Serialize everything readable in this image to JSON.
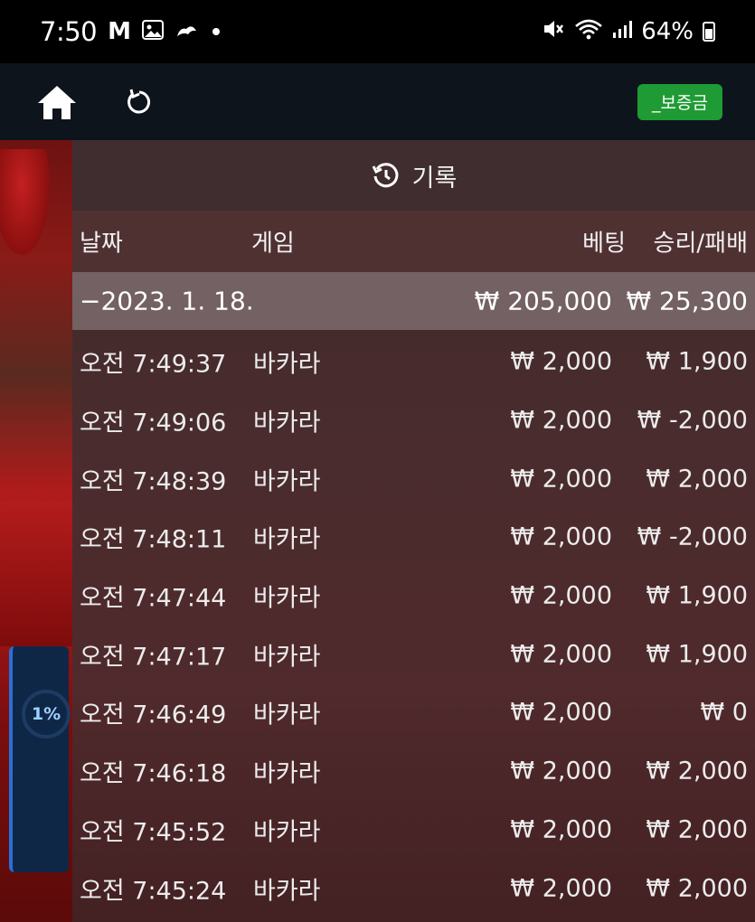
{
  "status_bar": {
    "time": "7:50",
    "app_icons": [
      "gmail-icon",
      "gallery-icon",
      "weather-icon"
    ],
    "battery": "64%"
  },
  "toolbar": {
    "deposit_label": "_보증금"
  },
  "left_overlay": {
    "percent": "1%"
  },
  "panel": {
    "title": "기록",
    "columns": {
      "date": "날짜",
      "game": "게임",
      "bet": "베팅",
      "win": "승리/패배"
    },
    "date_row": {
      "date": "−2023. 1. 18.",
      "bet": "₩ 205,000",
      "win": "₩ 25,300"
    },
    "rows": [
      {
        "time": "오전 7:49:37",
        "game": "바카라",
        "bet": "₩ 2,000",
        "win": "₩ 1,900"
      },
      {
        "time": "오전 7:49:06",
        "game": "바카라",
        "bet": "₩ 2,000",
        "win": "₩ -2,000"
      },
      {
        "time": "오전 7:48:39",
        "game": "바카라",
        "bet": "₩ 2,000",
        "win": "₩ 2,000"
      },
      {
        "time": "오전 7:48:11",
        "game": "바카라",
        "bet": "₩ 2,000",
        "win": "₩ -2,000"
      },
      {
        "time": "오전 7:47:44",
        "game": "바카라",
        "bet": "₩ 2,000",
        "win": "₩ 1,900"
      },
      {
        "time": "오전 7:47:17",
        "game": "바카라",
        "bet": "₩ 2,000",
        "win": "₩ 1,900"
      },
      {
        "time": "오전 7:46:49",
        "game": "바카라",
        "bet": "₩ 2,000",
        "win": "₩ 0"
      },
      {
        "time": "오전 7:46:18",
        "game": "바카라",
        "bet": "₩ 2,000",
        "win": "₩ 2,000"
      },
      {
        "time": "오전 7:45:52",
        "game": "바카라",
        "bet": "₩ 2,000",
        "win": "₩ 2,000"
      },
      {
        "time": "오전 7:45:24",
        "game": "바카라",
        "bet": "₩ 2,000",
        "win": "₩ 2,000"
      }
    ]
  },
  "colors": {
    "deposit_button": "#1e9b34",
    "toolbar_bg": "#0e141c",
    "date_row_bg": "#847476"
  }
}
